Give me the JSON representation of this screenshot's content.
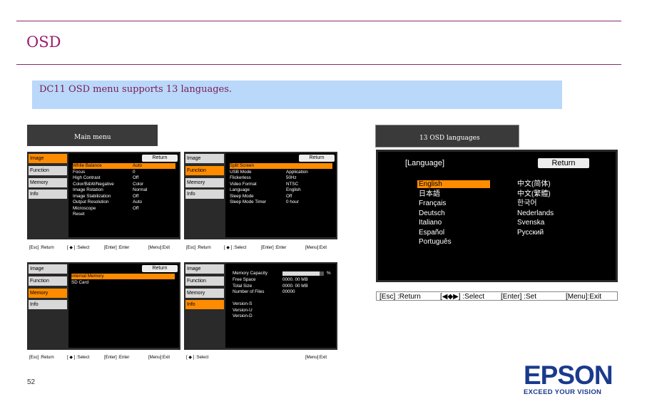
{
  "page": {
    "title": "OSD",
    "banner": "DC11 OSD menu supports 13 languages.",
    "page_number": "52"
  },
  "labels": {
    "main_menu": "Main menu",
    "languages": "13 OSD languages"
  },
  "tabs": [
    "Image",
    "Function",
    "Memory",
    "Info"
  ],
  "return_label": "Return",
  "screen_image": {
    "rows": [
      {
        "name": "White Balance",
        "value": "Auto"
      },
      {
        "name": "Focus",
        "value": "0"
      },
      {
        "name": "High Contrast",
        "value": "Off"
      },
      {
        "name": "Color/B&W/Negative",
        "value": "Color"
      },
      {
        "name": "Image Rotation",
        "value": "Normal"
      },
      {
        "name": "Image Stabilization",
        "value": "Off"
      },
      {
        "name": "Output Resolution",
        "value": "Auto"
      },
      {
        "name": "Microscope",
        "value": "Off"
      },
      {
        "name": "Reset",
        "value": ""
      }
    ],
    "bar": {
      "esc": "[Esc] :Return",
      "sel": "[ ◆ ] :Select",
      "enter": "[Enter] :Enter",
      "menu": "[Menu]:Exit"
    }
  },
  "screen_function": {
    "rows": [
      {
        "name": "Split Screen",
        "value": ""
      },
      {
        "name": "USB Mode",
        "value": "Application"
      },
      {
        "name": "Flickerless",
        "value": "50Hz"
      },
      {
        "name": "Video Format",
        "value": "NTSC"
      },
      {
        "name": "Language",
        "value": "English"
      },
      {
        "name": "Sleep Mode",
        "value": "Off"
      },
      {
        "name": "Sleep Mode Timer",
        "value": "0 hour"
      }
    ],
    "bar": {
      "esc": "[Esc] :Return",
      "sel": "[ ◆ ] :Select",
      "enter": "[Enter] :Enter",
      "menu": "[Menu]:Exit"
    }
  },
  "screen_memory": {
    "rows": [
      {
        "name": "Internal Memory",
        "value": ""
      },
      {
        "name": "SD Card",
        "value": ""
      }
    ],
    "bar": {
      "esc": "[Esc] :Return",
      "sel": "[ ◆ ] :Select",
      "enter": "[Enter] :Enter",
      "menu": "[Menu]:Exit"
    }
  },
  "screen_info": {
    "memory_capacity_label": "Memory Capacity",
    "capacity_unit": "%",
    "memory_capacity_fraction": 0.9,
    "rows": [
      {
        "name": "Free Space",
        "value": "0000. 00 MB"
      },
      {
        "name": "Total Size",
        "value": "0000. 00 MB"
      },
      {
        "name": "Number of Files",
        "value": "00000"
      }
    ],
    "versions": [
      "Version-S",
      "Version-U",
      "Version-D"
    ],
    "bar": {
      "sel": "[ ◆ ] :Select",
      "menu": "[Menu]:Exit"
    }
  },
  "language_screen": {
    "header": "[Language]",
    "return": "Return",
    "left": [
      "English",
      "日本語",
      "Français",
      "Deutsch",
      "Italiano",
      "Español",
      "Português"
    ],
    "right": [
      "中文(简体)",
      "中文(繁體)",
      "한국어",
      "Nederlands",
      "Svenska",
      "Русский"
    ],
    "bar": {
      "esc": "[Esc] :Return",
      "sel": "[◀◆▶] :Select",
      "enter": "[Enter] :Set",
      "menu": "[Menu]:Exit"
    }
  },
  "logo": {
    "brand": "EPSON",
    "tagline": "EXCEED YOUR VISION",
    "color": "#1a3a8c"
  },
  "colors": {
    "highlight": "#ff8c00",
    "title": "#9b1b6e",
    "banner_bg": "#b9d8fa"
  }
}
